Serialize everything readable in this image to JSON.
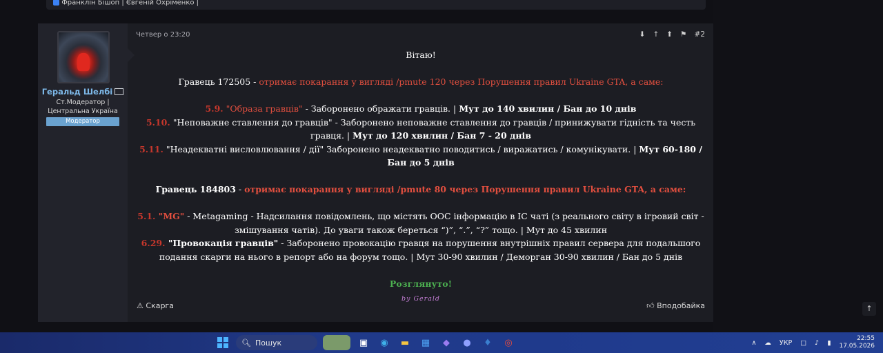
{
  "prev_post": {
    "participants": "Франклін Бішоп | Євгеній Охріменко |"
  },
  "post": {
    "date": "Четвер о 23:20",
    "number": "#2",
    "user": {
      "name": "Геральд Шелбі",
      "title_line1": "Ст.Модератор |",
      "title_line2": "Центральна Україна",
      "badge": "Модератор"
    },
    "greeting": "Вітаю!",
    "p1": {
      "player": "Гравець 172505",
      "dash": " - ",
      "punishment": "отримає покарання у вигляді /pmute 120 через Порушення правил Ukraine GTA, а саме:"
    },
    "rules1": [
      {
        "code": "5.9.",
        "name": "\"Образа гравців\"",
        "text": " - Заборонено ображати гравців. | ",
        "penalty": "Мут до 140 хвилин / Бан до 10 днів"
      },
      {
        "code": "5.10.",
        "name": " \"Неповажне ставлення до гравців\"",
        "text": " - Заборонено неповажне ставлення до гравців / принижувати гідність та честь гравця. | ",
        "penalty": "Мут до 120 хвилин / Бан 7 - 20 днів"
      },
      {
        "code": "5.11.",
        "name": " \"Неадекватні висловлювання / дії\"",
        "text": " Заборонено неадекватно поводитись / виражатись / комунікувати. | ",
        "penalty": "Мут 60-180 / Бан до 5 днів"
      }
    ],
    "p2": {
      "player": "Гравець 184803",
      "dash": " - ",
      "punishment": "отримає покарання у вигляді /pmute 80 через Порушення правил Ukraine GTA, а саме:"
    },
    "rules2": [
      {
        "code": "5.1.",
        "name": " \"MG\"",
        "text": " - Metagaming - Надсилання повідомлень, що містять OOC інформацію в IC чаті (з реального світу в ігровий світ - змішування чатів). До уваги також береться “)”, “.”, “?” тощо. | Мут до 45 хвилин"
      },
      {
        "code": "6.29.",
        "name": " \"Провокація гравців\"",
        "text": " - Заборонено провокацію гравця на порушення внутрішніх правил сервера для подальшого подання скарги на нього в репорт або на форум тощо. | Мут 30-90 хвилин / Деморган 30-90 хвилин / Бан до 5 днів"
      }
    ],
    "status": "Розглянуто!",
    "signature": "by Gerald",
    "report_label": "Скарга",
    "like_label": "Вподобайка"
  },
  "taskbar": {
    "search_placeholder": "Пошук",
    "language": "УКР",
    "time": "22:55",
    "date": "17.05.2026"
  },
  "colors": {
    "accent_red": "#e24f3f",
    "status_green": "#4caf50",
    "username_blue": "#7db8e8",
    "badge_blue": "#6aa2cf"
  }
}
